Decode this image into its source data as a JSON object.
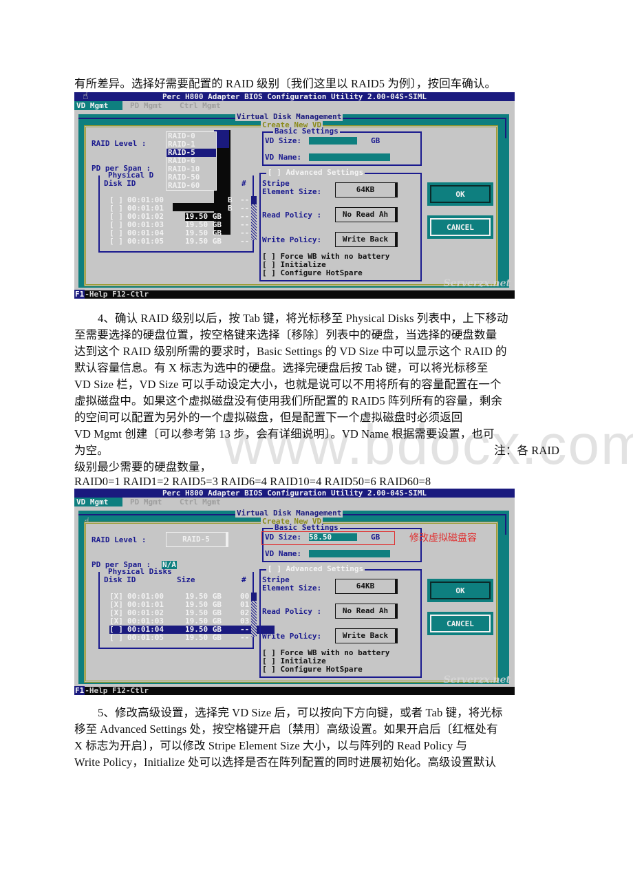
{
  "watermark": "www.bdocx.com",
  "paragraphs": {
    "intro": "有所差异。选择好需要配置的 RAID 级别〔我们这里以 RAID5 为例〕，按回车确认。",
    "step4_lines": [
      "4、确认 RAID 级别以后，按 Tab 键，将光标移至 Physical Disks 列表中，上下移动",
      "至需要选择的硬盘位置，按空格键来选择〔移除〕列表中的硬盘，当选择的硬盘数量",
      "达到这个 RAID 级别所需的要求时，Basic Settings 的 VD Size 中可以显示这个 RAID 的",
      "默认容量信息。有 X 标志为选中的硬盘。选择完硬盘后按 Tab 键，可以将光标移至",
      "VD Size 栏，VD Size 可以手动设定大小，也就是说可以不用将所有的容量配置在一个",
      "虚拟磁盘中。如果这个虚拟磁盘没有使用我们所配置的 RAID5 阵列所有的容量，剩余",
      "的空间可以配置为另外的一个虚拟磁盘，但是配置下一个虚拟磁盘时必须返回",
      "VD Mgmt 创建〔可以参考第 13 步，会有详细说明〕。VD Name 根据需要设置，也可"
    ],
    "step4_tail_left": "为空。",
    "step4_tail_right": "注：各 RAID",
    "step4_note": "级别最少需要的硬盘数量，",
    "raid_min_disks": "RAID0=1  RAID1=2  RAID5=3  RAID6=4 RAID10=4  RAID50=6 RAID60=8",
    "step5_lines": [
      "5、修改高级设置，选择完 VD Size 后，可以按向下方向键，或者 Tab 键，将光标",
      "移至 Advanced Settings 处，按空格键开启〔禁用〕高级设置。如果开启后〔红框处有",
      "X 标志为开启〕，可以修改 Stripe Element Size 大小，以与阵列的 Read Policy 与",
      "Write Policy，Initialize 处可以选择是否在阵列配置的同时进展初始化。高级设置默认"
    ]
  },
  "bios_common": {
    "title": "Perc H800 Adapter BIOS Configuration Utility 2.00-04S-SIML",
    "tabs": [
      "VD Mgmt",
      "PD Mgmt",
      "Ctrl Mgmt"
    ],
    "vdm_title": "Virtual Disk Management",
    "create_title": "Create New VD",
    "raid_level_label": "RAID Level :",
    "pd_per_span_label": "PD per Span :",
    "physical_disks_title": "Physical Disks",
    "physical_disks_title_truncated": "Physical D",
    "col_disk_id": "Disk ID",
    "col_size": "Size",
    "col_num": "#",
    "basic_settings_title": "Basic Settings",
    "vd_size_label": "VD Size:",
    "gb_unit": "GB",
    "vd_name_label": "VD Name:",
    "advanced_title": "[ ] Advanced Settings",
    "stripe_label_1": "Stripe",
    "stripe_label_2": "Element Size:",
    "stripe_value": "64KB",
    "read_policy_label": "Read Policy :",
    "read_policy_value": "No Read Ah",
    "write_policy_label": "Write Policy:",
    "write_policy_value": "Write Back",
    "options": [
      "[ ] Force WB with no battery",
      "[ ] Initialize",
      "[ ] Configure HotSpare"
    ],
    "ok": "OK",
    "cancel": "CANCEL",
    "status_f1": "F1",
    "status_rest": "-Help F12-Ctlr",
    "site_watermark": "Serverzx.net"
  },
  "screen1": {
    "raid_options": [
      "RAID-0",
      "RAID-1",
      "RAID-5",
      "RAID-6",
      "RAID-10",
      "RAID-50",
      "RAID-60"
    ],
    "selected_raid": "RAID-5",
    "disks": [
      {
        "check": "[ ]",
        "id": "00:01:00",
        "size": "B",
        "num": "--"
      },
      {
        "check": "[ ]",
        "id": "00:01:01",
        "size": "B",
        "num": "--"
      },
      {
        "check": "[ ]",
        "id": "00:01:02",
        "size": "19.50 GB",
        "num": "--"
      },
      {
        "check": "[ ]",
        "id": "00:01:03",
        "size": "19.50 GB",
        "num": "--"
      },
      {
        "check": "[ ]",
        "id": "00:01:04",
        "size": "19.50 GB",
        "num": "--"
      },
      {
        "check": "[ ]",
        "id": "00:01:05",
        "size": "19.50 GB",
        "num": "--"
      }
    ],
    "vd_size": "",
    "vd_name": ""
  },
  "screen2": {
    "raid_level_value": "RAID-5",
    "pd_per_span_value": "N/A",
    "disks": [
      {
        "check": "[X]",
        "id": "00:01:00",
        "size": "19.50 GB",
        "num": "00"
      },
      {
        "check": "[X]",
        "id": "00:01:01",
        "size": "19.50 GB",
        "num": "01"
      },
      {
        "check": "[X]",
        "id": "00:01:02",
        "size": "19.50 GB",
        "num": "02"
      },
      {
        "check": "[X]",
        "id": "00:01:03",
        "size": "19.50 GB",
        "num": "03"
      },
      {
        "check": "[ ]",
        "id": "00:01:04",
        "size": "19.50 GB",
        "num": "--"
      },
      {
        "check": "[ ]",
        "id": "00:01:05",
        "size": "19.50 GB",
        "num": "--"
      }
    ],
    "highlighted_disk_index": 4,
    "vd_size": "58.50",
    "vd_name": "",
    "annotation": "修改虚拟磁盘容"
  }
}
